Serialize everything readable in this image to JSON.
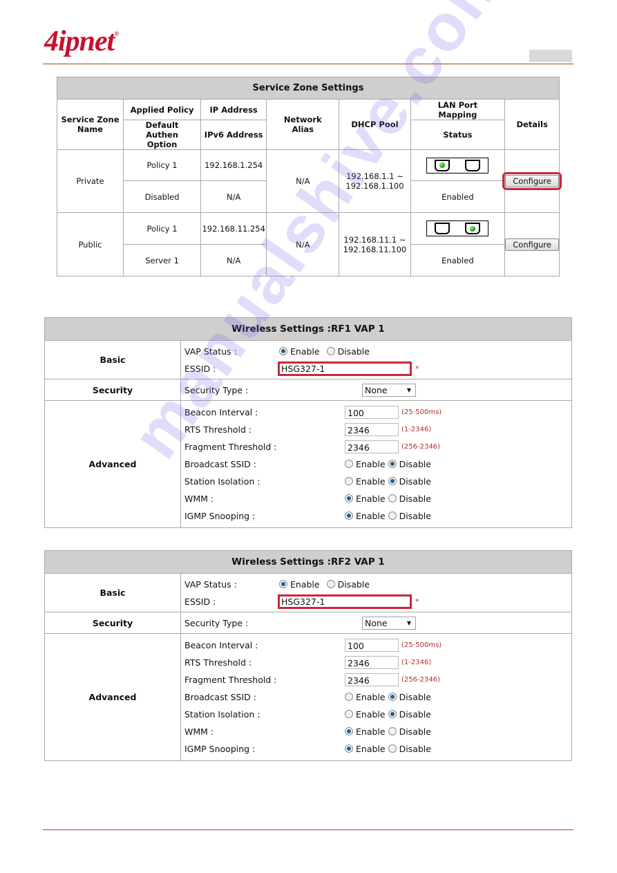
{
  "brand": {
    "logo_text": "4ipnet",
    "logo_mark": "®",
    "color": "#c8102e"
  },
  "service_zone": {
    "title": "Service Zone Settings",
    "headers": {
      "name": "Service Zone Name",
      "applied_policy": "Applied Policy",
      "default_authen": "Default Authen Option",
      "ip_address": "IP Address",
      "ipv6_address": "IPv6 Address",
      "network_alias": "Network Alias",
      "dhcp_pool": "DHCP Pool",
      "lan_port_mapping": "LAN Port Mapping",
      "status": "Status",
      "details": "Details"
    },
    "rows": [
      {
        "name": "Private",
        "applied_policy": "Policy 1",
        "default_authen": "Disabled",
        "ip_address": "192.168.1.254",
        "ipv6_address": "N/A",
        "network_alias": "N/A",
        "dhcp_pool_1": "192.168.1.1 ~",
        "dhcp_pool_2": "192.168.1.100",
        "lan_ports": [
          true,
          false
        ],
        "status": "Enabled",
        "button": "Configure",
        "highlighted": true
      },
      {
        "name": "Public",
        "applied_policy": "Policy 1",
        "default_authen": "Server 1",
        "ip_address": "192.168.11.254",
        "ipv6_address": "N/A",
        "network_alias": "N/A",
        "dhcp_pool_1": "192.168.11.1 ~",
        "dhcp_pool_2": "192.168.11.100",
        "lan_ports": [
          false,
          true
        ],
        "status": "Enabled",
        "button": "Configure",
        "highlighted": false
      }
    ]
  },
  "wireless": [
    {
      "title": "Wireless Settings :RF1 VAP 1",
      "sections": {
        "basic": "Basic",
        "security": "Security",
        "advanced": "Advanced"
      },
      "vap_status_label": "VAP Status :",
      "essid_label": "ESSID :",
      "essid_value": "HSG327-1",
      "required_mark": "*",
      "security_type_label": "Security Type :",
      "security_type_value": "None",
      "enable": "Enable",
      "disable": "Disable",
      "vap_status": "Enable",
      "beacon_label": "Beacon Interval :",
      "beacon_value": "100",
      "beacon_range": "(25-500ms)",
      "rts_label": "RTS Threshold :",
      "rts_value": "2346",
      "rts_range": "(1-2346)",
      "frag_label": "Fragment Threshold :",
      "frag_value": "2346",
      "frag_range": "(256-2346)",
      "bssid_label": "Broadcast SSID :",
      "bssid": "Disable",
      "iso_label": "Station Isolation :",
      "iso": "Disable",
      "wmm_label": "WMM :",
      "wmm": "Enable",
      "igmp_label": "IGMP Snooping :",
      "igmp": "Enable"
    },
    {
      "title": "Wireless Settings :RF2 VAP 1",
      "sections": {
        "basic": "Basic",
        "security": "Security",
        "advanced": "Advanced"
      },
      "vap_status_label": "VAP Status :",
      "essid_label": "ESSID :",
      "essid_value": "HSG327-1",
      "required_mark": "*",
      "security_type_label": "Security Type :",
      "security_type_value": "None",
      "enable": "Enable",
      "disable": "Disable",
      "vap_status": "Enable",
      "beacon_label": "Beacon Interval :",
      "beacon_value": "100",
      "beacon_range": "(25-500ms)",
      "rts_label": "RTS Threshold :",
      "rts_value": "2346",
      "rts_range": "(1-2346)",
      "frag_label": "Fragment Threshold :",
      "frag_value": "2346",
      "frag_range": "(256-2346)",
      "bssid_label": "Broadcast SSID :",
      "bssid": "Disable",
      "iso_label": "Station Isolation :",
      "iso": "Disable",
      "wmm_label": "WMM :",
      "wmm": "Enable",
      "igmp_label": "IGMP Snooping :",
      "igmp": "Enable"
    }
  ],
  "watermark": "manualshive.com"
}
